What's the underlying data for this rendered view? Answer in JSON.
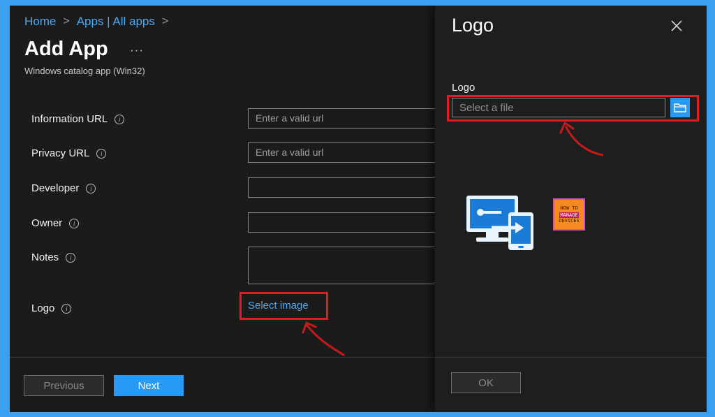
{
  "breadcrumb": {
    "home": "Home",
    "apps": "Apps | All apps",
    "sep": ">"
  },
  "header": {
    "title": "Add App",
    "more": "···",
    "subtitle": "Windows catalog app (Win32)"
  },
  "form": {
    "information_url": {
      "label": "Information URL",
      "placeholder": "Enter a valid url"
    },
    "privacy_url": {
      "label": "Privacy URL",
      "placeholder": "Enter a valid url"
    },
    "developer": {
      "label": "Developer",
      "value": ""
    },
    "owner": {
      "label": "Owner",
      "value": ""
    },
    "notes": {
      "label": "Notes",
      "value": ""
    },
    "logo": {
      "label": "Logo",
      "link": "Select image"
    }
  },
  "footer": {
    "previous": "Previous",
    "next": "Next"
  },
  "panel": {
    "title": "Logo",
    "field_label": "Logo",
    "file_placeholder": "Select a file",
    "ok": "OK",
    "watermark": {
      "line1": "HOW TO",
      "line2": "MANAGE",
      "line3": "DEVICES"
    }
  },
  "icons": {
    "info": "info-icon",
    "close": "close-icon",
    "browse": "folder-icon",
    "app": "remote-desktop-app-icon"
  },
  "colors": {
    "accent": "#2899f5",
    "link": "#4ea8ef",
    "highlight": "#e31b23",
    "background": "#1b1b1b",
    "border": "#3aa0f0"
  }
}
